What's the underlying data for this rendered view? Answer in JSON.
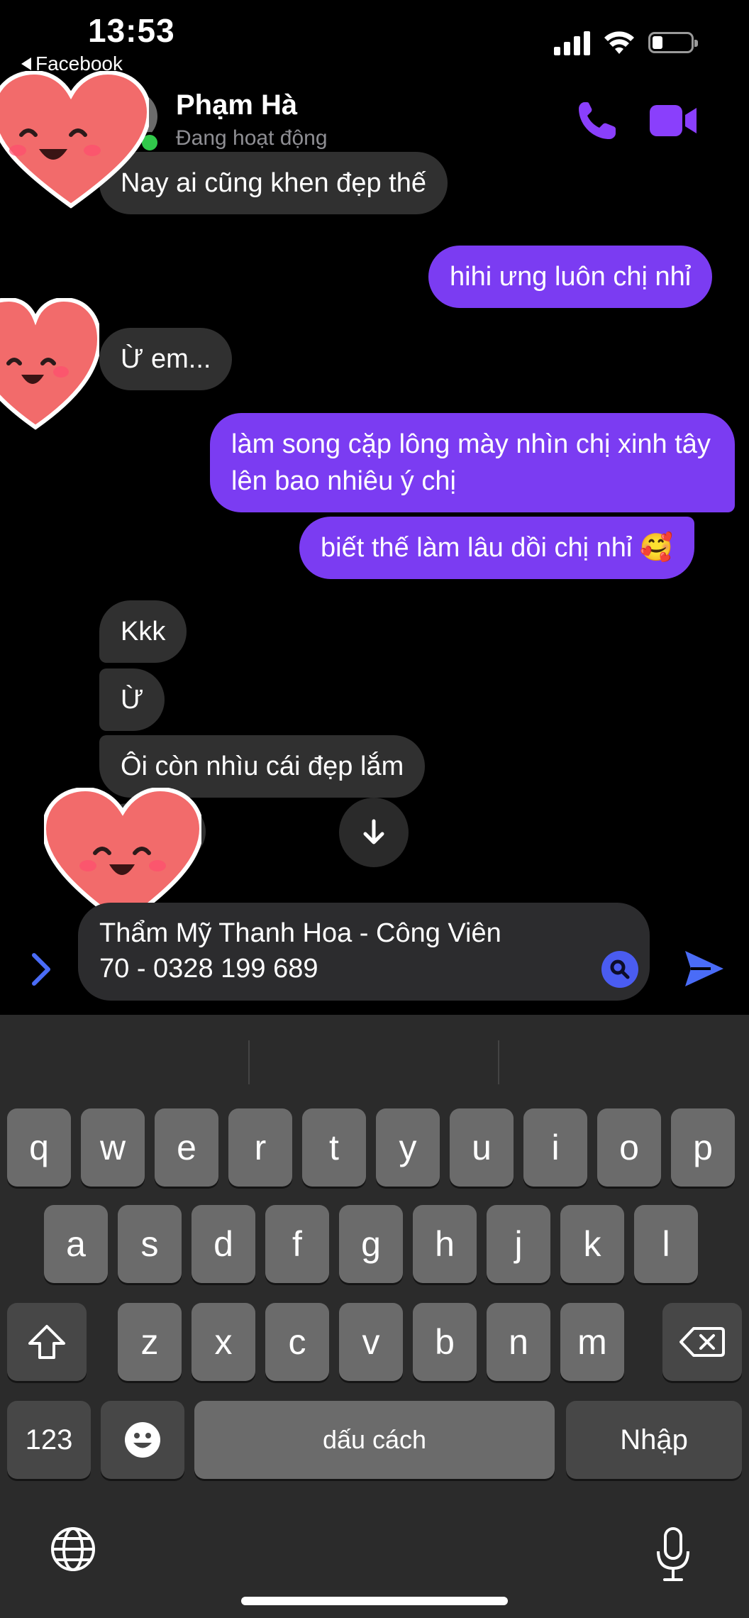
{
  "status_bar": {
    "time": "13:53",
    "back_app": "Facebook",
    "icons": [
      "cellular-signal-icon",
      "wifi-icon",
      "battery-icon"
    ]
  },
  "header": {
    "contact_name": "Phạm Hà",
    "contact_status": "Đang hoạt động",
    "actions": [
      "phone-icon",
      "video-camera-icon"
    ],
    "accent_color": "#8a3ffc"
  },
  "messages": [
    {
      "side": "in",
      "text": "Nay ai cũng khen đẹp thế"
    },
    {
      "side": "out",
      "text": "hihi ưng luôn chị nhỉ"
    },
    {
      "side": "in",
      "text": "Ừ em..."
    },
    {
      "side": "out",
      "text": "làm song cặp lông mày nhìn chị xinh tây lên bao nhiêu ý chị"
    },
    {
      "side": "out",
      "text": "biết thế làm lâu dồi chị nhỉ 🥰"
    },
    {
      "side": "in",
      "text": "Kkk"
    },
    {
      "side": "in",
      "text": "Ừ"
    },
    {
      "side": "in",
      "text": "Ôi còn nhìu cái đẹp lắm"
    }
  ],
  "composer": {
    "value": "Thẩm Mỹ Thanh Hoa - Công Viên\n70 - 0328 199 689"
  },
  "keyboard": {
    "row1": [
      "q",
      "w",
      "e",
      "r",
      "t",
      "y",
      "u",
      "i",
      "o",
      "p"
    ],
    "row2": [
      "a",
      "s",
      "d",
      "f",
      "g",
      "h",
      "j",
      "k",
      "l"
    ],
    "row3": [
      "z",
      "x",
      "c",
      "v",
      "b",
      "n",
      "m"
    ],
    "numbers_key": "123",
    "space_key": "dấu cách",
    "return_key": "Nhập"
  },
  "colors": {
    "outgoing_bubble": "#7b3cf2",
    "incoming_bubble": "#303030",
    "send_button": "#4a6cf7"
  }
}
